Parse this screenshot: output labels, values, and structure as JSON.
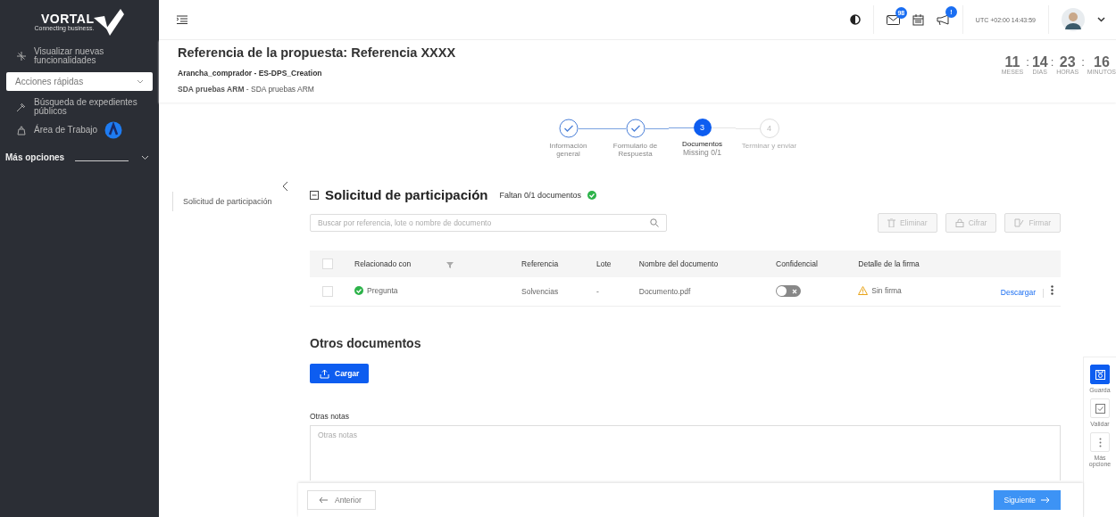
{
  "sidebar": {
    "logo": {
      "name": "VORTAL",
      "tagline": "Connecting business."
    },
    "items": [
      {
        "kind": "link",
        "label": "Visualizar nuevas funcionalidades",
        "badge": false
      },
      {
        "kind": "select",
        "label": "Acciones rápidas"
      },
      {
        "kind": "link",
        "label": "Búsqueda de expedientes públicos",
        "badge": false
      },
      {
        "kind": "link",
        "label": "Área de Trabajo",
        "badge": true
      },
      {
        "kind": "section",
        "label": "Más opciones"
      }
    ]
  },
  "topbar": {
    "mail_count": "98",
    "notice_count": "!",
    "clock": "UTC +02:00 14:43:59"
  },
  "header": {
    "title": "Referencia de la propuesta: Referencia XXXX",
    "line1": "Arancha_comprador - ES-DPS_Creation",
    "line2_bold": "SDA pruebas ARM",
    "line2": " - SDA pruebas ARM",
    "separator": ":",
    "countdown": [
      {
        "value": "11",
        "unit": "MESES"
      },
      {
        "value": "14",
        "unit": "DIAS"
      },
      {
        "value": "23",
        "unit": "HORAS"
      },
      {
        "value": "16",
        "unit": "MINUTOS"
      }
    ]
  },
  "steps": [
    {
      "kind": "done",
      "label": "Información general"
    },
    {
      "kind": "done",
      "label": "Formulario de Respuesta"
    },
    {
      "kind": "current",
      "marker": "3",
      "label": "Documentos",
      "sub": "Missing 0/1"
    },
    {
      "kind": "pending",
      "marker": "4",
      "label": "Terminar y enviar"
    }
  ],
  "side_nav": [
    {
      "label": "Solicitud de participación",
      "selected": false
    }
  ],
  "section": {
    "title": "Solicitud de participación",
    "status": "Faltan 0/1 documentos",
    "complete": true,
    "search": {
      "placeholder": "Buscar por referencia, lote o nombre de documento"
    },
    "actions": [
      {
        "kind": "delete",
        "label": "Eliminar",
        "disabled": true
      },
      {
        "kind": "lock",
        "label": "Cifrar",
        "disabled": true
      },
      {
        "kind": "sign",
        "label": "Firmar",
        "disabled": true
      }
    ],
    "table": {
      "all_checked": false,
      "columns": [
        "Relacionado con",
        "Referencia",
        "Lote",
        "Nombre del documento",
        "Confidencial",
        "Detalle de la firma"
      ],
      "rows": [
        {
          "checked": false,
          "related": "Pregunta",
          "reference": "Solvencias",
          "lot": "-",
          "document": "Documento.pdf",
          "confidential": false,
          "signature": "Sin firma",
          "action": "Descargar"
        }
      ]
    }
  },
  "other": {
    "title": "Otros documentos",
    "upload": "Cargar",
    "notes_label": "Otras notas",
    "notes_placeholder": "Otras notas"
  },
  "footer": {
    "back": "Anterior",
    "next": "Siguiente"
  },
  "rail": [
    {
      "kind": "save",
      "label": "Guarda",
      "primary": true
    },
    {
      "kind": "check",
      "label": "Validar",
      "primary": false
    },
    {
      "kind": "more",
      "label": "Más opcione",
      "primary": false
    }
  ]
}
